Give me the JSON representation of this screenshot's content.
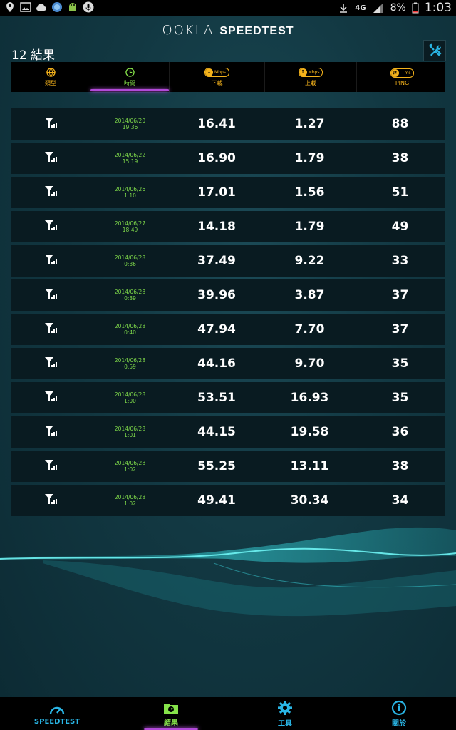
{
  "status_bar": {
    "battery": "8%",
    "time": "1:03",
    "network": "4G"
  },
  "header": {
    "logo_ookla": "OOKLA",
    "logo_speedtest": "SPEEDTEST",
    "results_count": "12 結果"
  },
  "columns": {
    "type": "類型",
    "time": "時間",
    "download": "下載",
    "upload": "上載",
    "ping": "PING",
    "mbps": "Mbps",
    "ms": "ms"
  },
  "results": [
    {
      "date": "2014/06/20",
      "time": "19:36",
      "download": "16.41",
      "upload": "1.27",
      "ping": "88"
    },
    {
      "date": "2014/06/22",
      "time": "15:19",
      "download": "16.90",
      "upload": "1.79",
      "ping": "38"
    },
    {
      "date": "2014/06/26",
      "time": "1:10",
      "download": "17.01",
      "upload": "1.56",
      "ping": "51"
    },
    {
      "date": "2014/06/27",
      "time": "18:49",
      "download": "14.18",
      "upload": "1.79",
      "ping": "49"
    },
    {
      "date": "2014/06/28",
      "time": "0:36",
      "download": "37.49",
      "upload": "9.22",
      "ping": "33"
    },
    {
      "date": "2014/06/28",
      "time": "0:39",
      "download": "39.96",
      "upload": "3.87",
      "ping": "37"
    },
    {
      "date": "2014/06/28",
      "time": "0:40",
      "download": "47.94",
      "upload": "7.70",
      "ping": "37"
    },
    {
      "date": "2014/06/28",
      "time": "0:59",
      "download": "44.16",
      "upload": "9.70",
      "ping": "35"
    },
    {
      "date": "2014/06/28",
      "time": "1:00",
      "download": "53.51",
      "upload": "16.93",
      "ping": "35"
    },
    {
      "date": "2014/06/28",
      "time": "1:01",
      "download": "44.15",
      "upload": "19.58",
      "ping": "36"
    },
    {
      "date": "2014/06/28",
      "time": "1:02",
      "download": "55.25",
      "upload": "13.11",
      "ping": "38"
    },
    {
      "date": "2014/06/28",
      "time": "1:02",
      "download": "49.41",
      "upload": "30.34",
      "ping": "34"
    }
  ],
  "nav": {
    "speedtest": "SPEEDTEST",
    "results": "結果",
    "tools": "工具",
    "about": "關於"
  },
  "colors": {
    "accent_orange": "#f4b21b",
    "accent_green": "#86e34a",
    "accent_blue": "#2ab6e6",
    "active_indicator": "#b14ad8"
  },
  "icons": [
    "signal-icon",
    "clock-icon",
    "globe-icon",
    "download-icon",
    "upload-icon",
    "ping-icon",
    "tools-icon",
    "gauge-icon",
    "results-icon",
    "gear-icon",
    "info-icon"
  ]
}
